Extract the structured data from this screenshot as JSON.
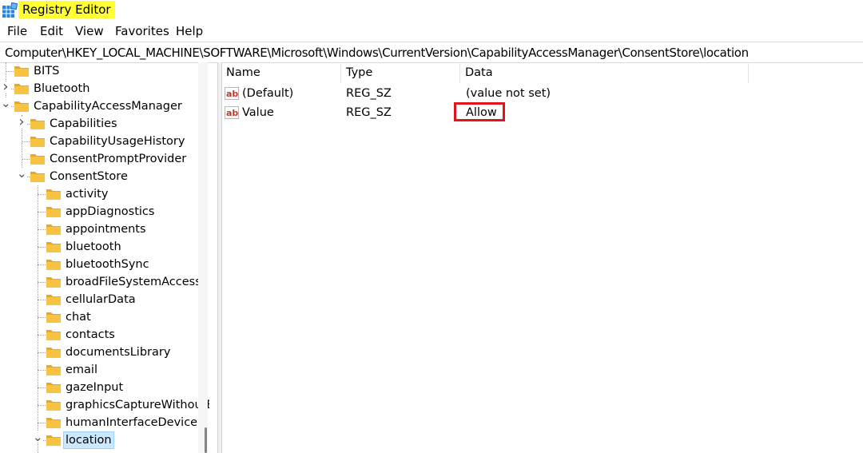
{
  "window": {
    "title": "Registry Editor",
    "highlight_color": "#ffff33"
  },
  "menu": {
    "items": [
      "File",
      "Edit",
      "View",
      "Favorites",
      "Help"
    ]
  },
  "address": {
    "path": "Computer\\HKEY_LOCAL_MACHINE\\SOFTWARE\\Microsoft\\Windows\\CurrentVersion\\CapabilityAccessManager\\ConsentStore\\location"
  },
  "tree": {
    "items": [
      {
        "label": "BITS",
        "depth": 0,
        "expander": "none"
      },
      {
        "label": "Bluetooth",
        "depth": 0,
        "expander": "collapsed"
      },
      {
        "label": "CapabilityAccessManager",
        "depth": 0,
        "expander": "expanded"
      },
      {
        "label": "Capabilities",
        "depth": 1,
        "expander": "collapsed"
      },
      {
        "label": "CapabilityUsageHistory",
        "depth": 1,
        "expander": "none"
      },
      {
        "label": "ConsentPromptProvider",
        "depth": 1,
        "expander": "none"
      },
      {
        "label": "ConsentStore",
        "depth": 1,
        "expander": "expanded"
      },
      {
        "label": "activity",
        "depth": 2,
        "expander": "none"
      },
      {
        "label": "appDiagnostics",
        "depth": 2,
        "expander": "none"
      },
      {
        "label": "appointments",
        "depth": 2,
        "expander": "none"
      },
      {
        "label": "bluetooth",
        "depth": 2,
        "expander": "none"
      },
      {
        "label": "bluetoothSync",
        "depth": 2,
        "expander": "none"
      },
      {
        "label": "broadFileSystemAccess",
        "depth": 2,
        "expander": "none"
      },
      {
        "label": "cellularData",
        "depth": 2,
        "expander": "none"
      },
      {
        "label": "chat",
        "depth": 2,
        "expander": "none"
      },
      {
        "label": "contacts",
        "depth": 2,
        "expander": "none"
      },
      {
        "label": "documentsLibrary",
        "depth": 2,
        "expander": "none"
      },
      {
        "label": "email",
        "depth": 2,
        "expander": "none"
      },
      {
        "label": "gazeInput",
        "depth": 2,
        "expander": "none"
      },
      {
        "label": "graphicsCaptureWithoutB",
        "depth": 2,
        "expander": "none"
      },
      {
        "label": "humanInterfaceDevice",
        "depth": 2,
        "expander": "none"
      },
      {
        "label": "location",
        "depth": 2,
        "expander": "expanded",
        "selected": true
      }
    ]
  },
  "list": {
    "columns": [
      "Name",
      "Type",
      "Data"
    ],
    "rows": [
      {
        "name": "(Default)",
        "type": "REG_SZ",
        "data": "(value not set)",
        "icon": "string-value-icon"
      },
      {
        "name": "Value",
        "type": "REG_SZ",
        "data": "Allow",
        "icon": "string-value-icon",
        "highlighted": true
      }
    ]
  },
  "colors": {
    "annotation_box": "#e0141b",
    "selection": "#cce8ff",
    "folder": "#f6c342"
  }
}
